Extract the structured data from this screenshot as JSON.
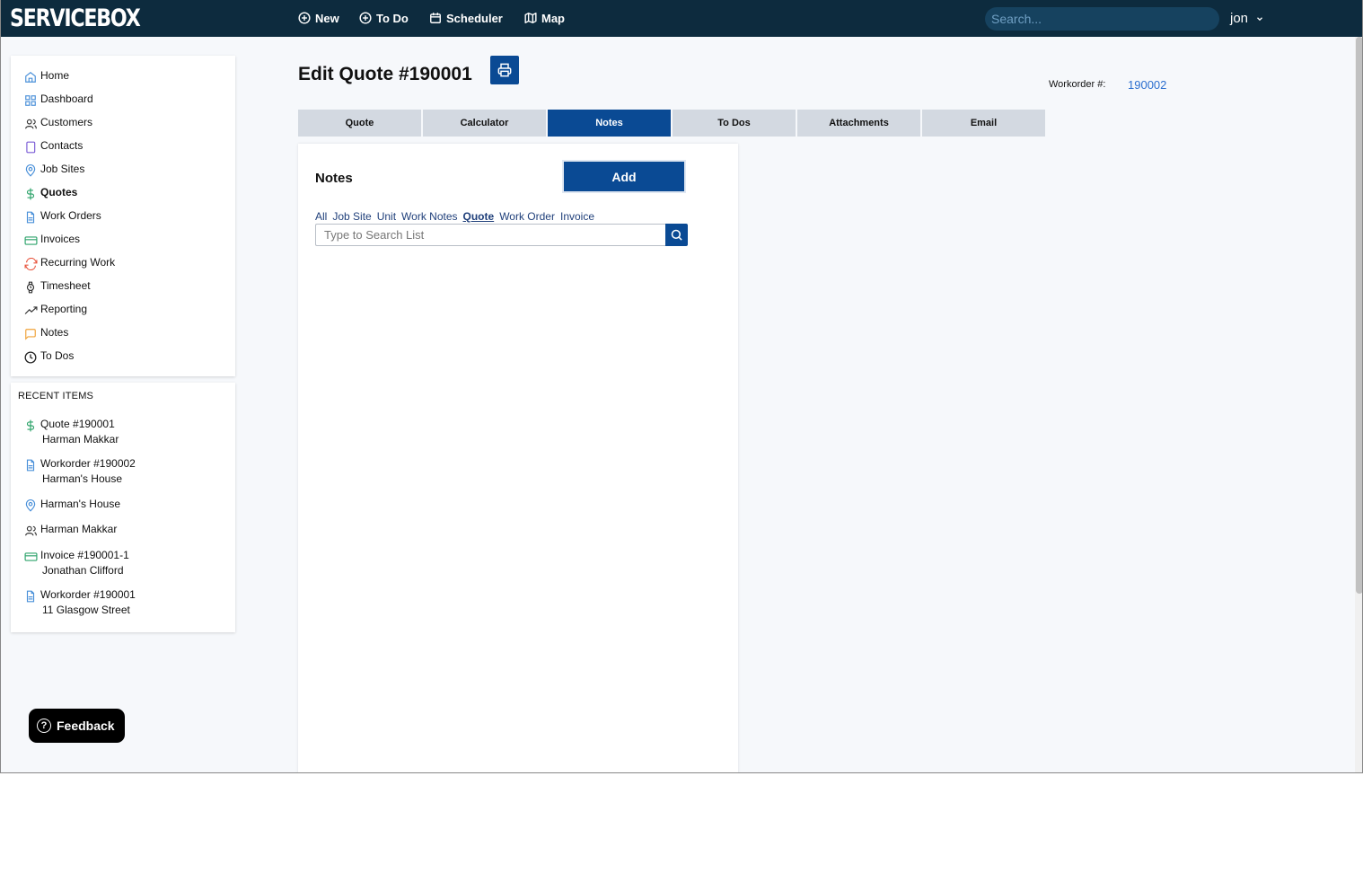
{
  "app": {
    "logo": "SERVICEBOX"
  },
  "topnav": {
    "items": [
      {
        "label": "New",
        "icon": "plus-circle-icon"
      },
      {
        "label": "To Do",
        "icon": "plus-circle-icon"
      },
      {
        "label": "Scheduler",
        "icon": "calendar-icon"
      },
      {
        "label": "Map",
        "icon": "map-icon"
      }
    ],
    "search_placeholder": "Search...",
    "user": "jon"
  },
  "sidebar": {
    "items": [
      {
        "label": "Home",
        "icon": "home-icon"
      },
      {
        "label": "Dashboard",
        "icon": "grid-icon"
      },
      {
        "label": "Customers",
        "icon": "users-icon"
      },
      {
        "label": "Contacts",
        "icon": "book-icon"
      },
      {
        "label": "Job Sites",
        "icon": "map-pin-icon"
      },
      {
        "label": "Quotes",
        "icon": "dollar-icon",
        "active": true
      },
      {
        "label": "Work Orders",
        "icon": "file-icon"
      },
      {
        "label": "Invoices",
        "icon": "credit-card-icon"
      },
      {
        "label": "Recurring Work",
        "icon": "refresh-icon"
      },
      {
        "label": "Timesheet",
        "icon": "watch-icon"
      },
      {
        "label": "Reporting",
        "icon": "trending-up-icon"
      },
      {
        "label": "Notes",
        "icon": "message-icon"
      },
      {
        "label": "To Dos",
        "icon": "clock-icon"
      }
    ]
  },
  "recent": {
    "title": "RECENT ITEMS",
    "items": [
      {
        "title": "Quote #190001",
        "subtitle": "Harman Makkar",
        "icon": "dollar-icon"
      },
      {
        "title": "Workorder #190002",
        "subtitle": "Harman's House",
        "icon": "file-icon"
      },
      {
        "title": "Harman's House",
        "subtitle": "",
        "icon": "map-pin-icon"
      },
      {
        "title": "Harman Makkar",
        "subtitle": "",
        "icon": "users-icon"
      },
      {
        "title": "Invoice #190001-1",
        "subtitle": "Jonathan Clifford",
        "icon": "credit-card-icon"
      },
      {
        "title": "Workorder #190001",
        "subtitle": "11 Glasgow Street",
        "icon": "file-icon"
      }
    ]
  },
  "feedback": {
    "label": "Feedback"
  },
  "page": {
    "title": "Edit Quote #190001",
    "workorder_label": "Workorder #:",
    "workorder_value": "190002"
  },
  "tabs": [
    {
      "label": "Quote"
    },
    {
      "label": "Calculator"
    },
    {
      "label": "Notes",
      "active": true
    },
    {
      "label": "To Dos"
    },
    {
      "label": "Attachments"
    },
    {
      "label": "Email"
    }
  ],
  "notes": {
    "title": "Notes",
    "add_label": "Add",
    "filters": [
      "All",
      "Job Site",
      "Unit",
      "Work Notes",
      "Quote",
      "Work Order",
      "Invoice"
    ],
    "active_filter": "Quote",
    "search_placeholder": "Type to Search List"
  },
  "colors": {
    "topbar": "#0d2b3e",
    "primary": "#0a4a94",
    "tab_inactive": "#d3d9e1",
    "link": "#2c6fcf"
  }
}
